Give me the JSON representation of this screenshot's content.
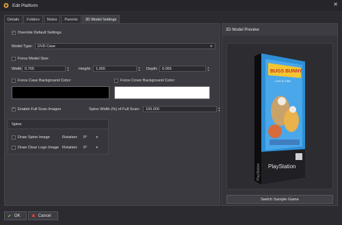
{
  "window": {
    "title": "Edit Platform",
    "close_glyph": "✕"
  },
  "tabs": [
    {
      "label": "Details"
    },
    {
      "label": "Folders"
    },
    {
      "label": "Notes"
    },
    {
      "label": "Parents"
    },
    {
      "label": "3D Model Settings",
      "active": true
    }
  ],
  "settings": {
    "override_default": {
      "label": "Override Default Settings",
      "checked": true
    },
    "model_type": {
      "label": "Model Type:",
      "value": "DVD Case"
    },
    "force_model_size": {
      "label": "Force Model Size:",
      "checked": false
    },
    "width": {
      "label": "Width:",
      "value": "0.700"
    },
    "height": {
      "label": "Height:",
      "value": "1.000"
    },
    "depth": {
      "label": "Depth:",
      "value": "0.065"
    },
    "force_case_bg": {
      "label": "Force Case Background Color:",
      "checked": false,
      "color": "#000000"
    },
    "force_cover_bg": {
      "label": "Force Cover Background Color:",
      "checked": false,
      "color": "#ffffff"
    },
    "enable_full_scan": {
      "label": "Enable Full Scan Images",
      "checked": true
    },
    "spine_width": {
      "label": "Spine Width (%) of Full Scan:",
      "value": "100.000"
    }
  },
  "spine": {
    "header": "Spine",
    "draw_spine_image": {
      "label": "Draw Spine Image",
      "checked": false,
      "rotation_label": "Rotation:",
      "rotation": "0°"
    },
    "draw_clear_logo": {
      "label": "Draw Clear Logo Image",
      "checked": false,
      "rotation_label": "Rotation:",
      "rotation": "0°"
    }
  },
  "preview": {
    "header": "3D Model Preview",
    "cover_title": "BUGS BUNNY",
    "cover_subtitle": "LOST IN TIME",
    "brand": "PlayStation",
    "spine_brand": "PlayStation",
    "switch_button": "Switch Sample Game"
  },
  "footer": {
    "ok": "OK",
    "cancel": "Cancel"
  },
  "colors": {
    "accent_green": "#6cc24a",
    "accent_red": "#e04646",
    "cover_blue": "#2e8fd6"
  }
}
